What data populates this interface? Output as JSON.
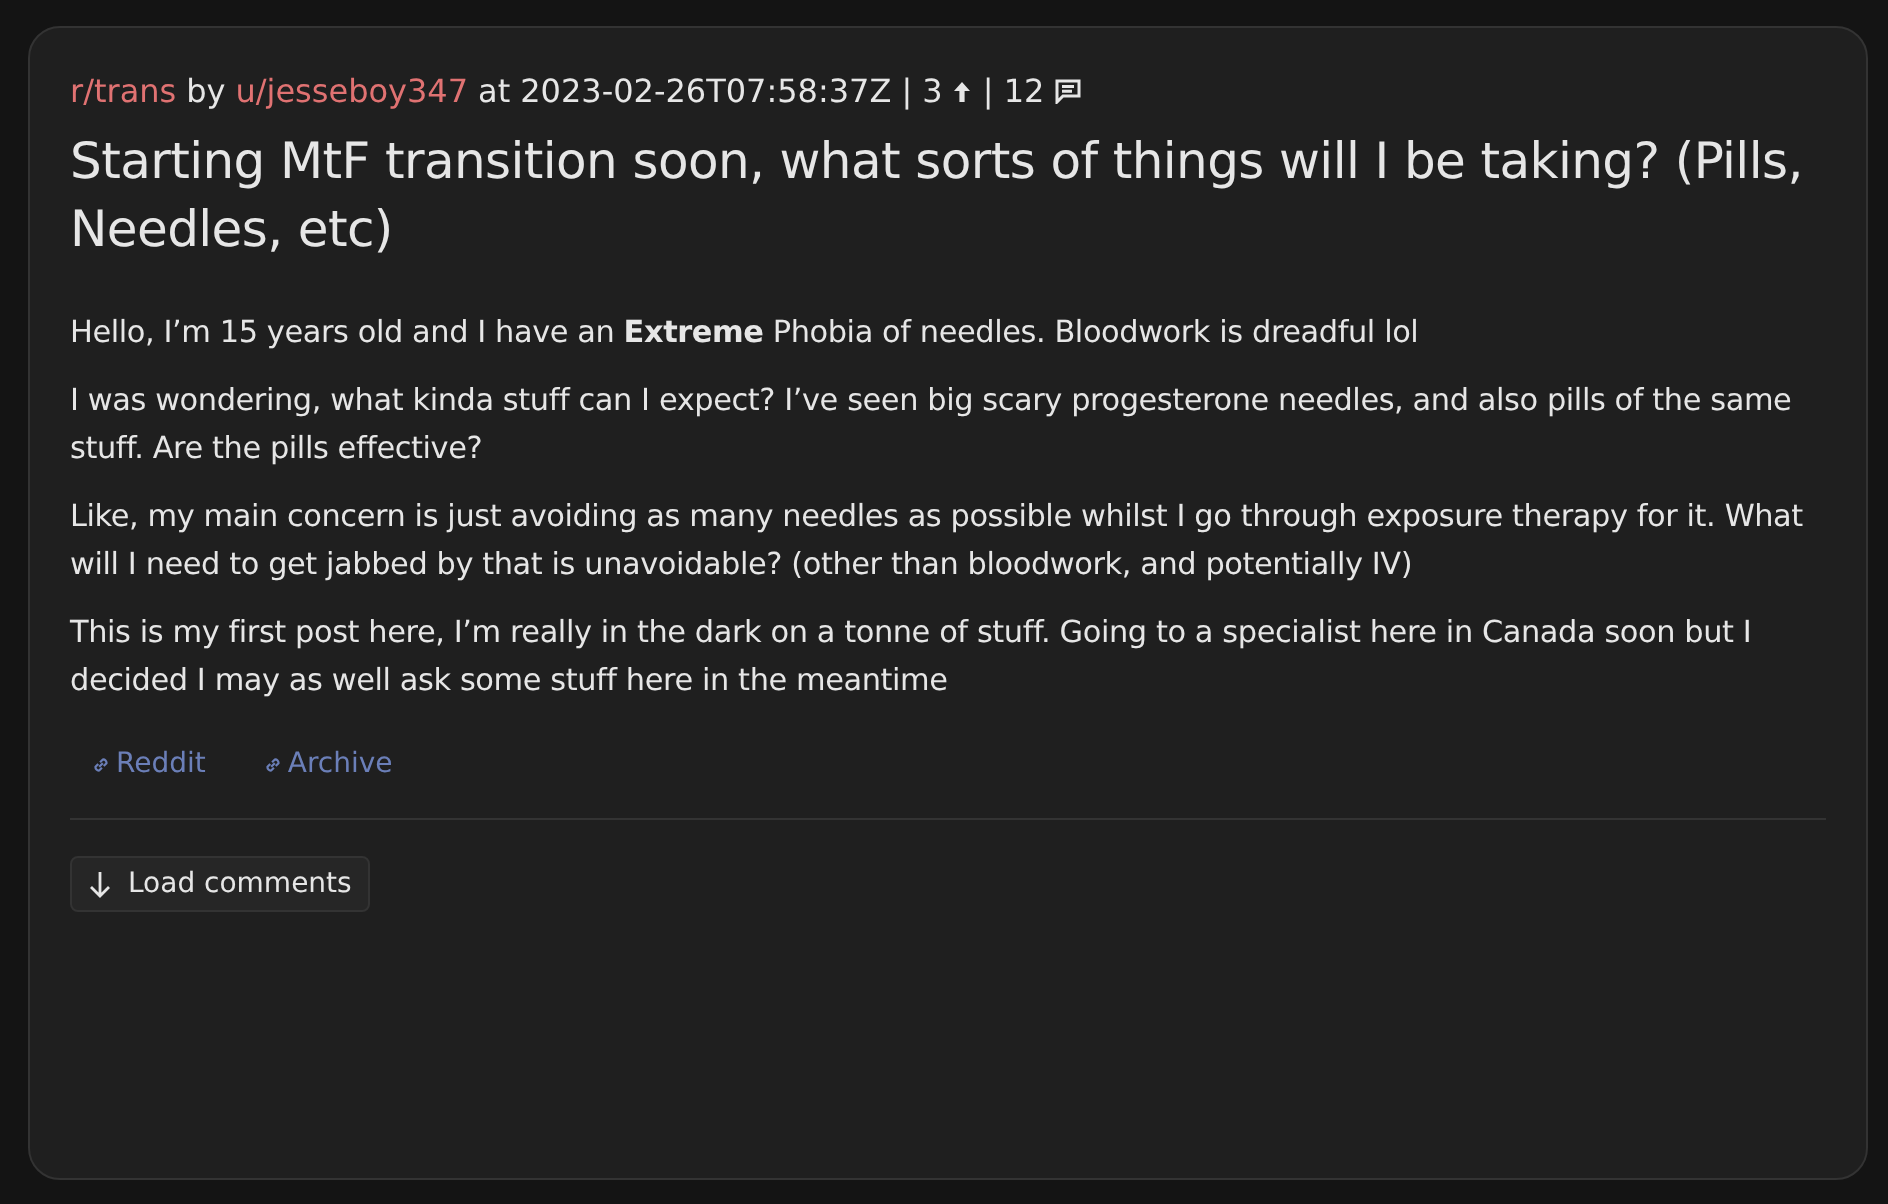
{
  "post": {
    "subreddit": "r/trans",
    "by": "by",
    "author": "u/jesseboy347",
    "at": "at",
    "timestamp": "2023-02-26T07:58:37Z",
    "score": "| 3",
    "comments": "| 12",
    "title": "Starting MtF transition soon, what sorts of things will I be taking? (Pills, Needles, etc)",
    "paragraphs": [
      "Hello, I’m 15 years old and I have an **Extreme** Phobia of needles. Bloodwork is dreadful lol",
      "I was wondering, what kinda stuff can I expect? I’ve seen big scary progesterone needles, and also pills of the same stuff. Are the pills effective?",
      "Like, my main concern is just avoiding as many needles as possible whilst I go through exposure therapy for it. What will I need to get jabbed by that is unavoidable? (other than bloodwork, and potentially IV)",
      "This is my first post here, I’m really in the dark on a tonne of stuff. Going to a specialist here in Canada soon but I decided I may as well ask some stuff here in the meantime"
    ],
    "links": [
      "Reddit",
      "Archive"
    ],
    "load_button": "Load comments"
  }
}
